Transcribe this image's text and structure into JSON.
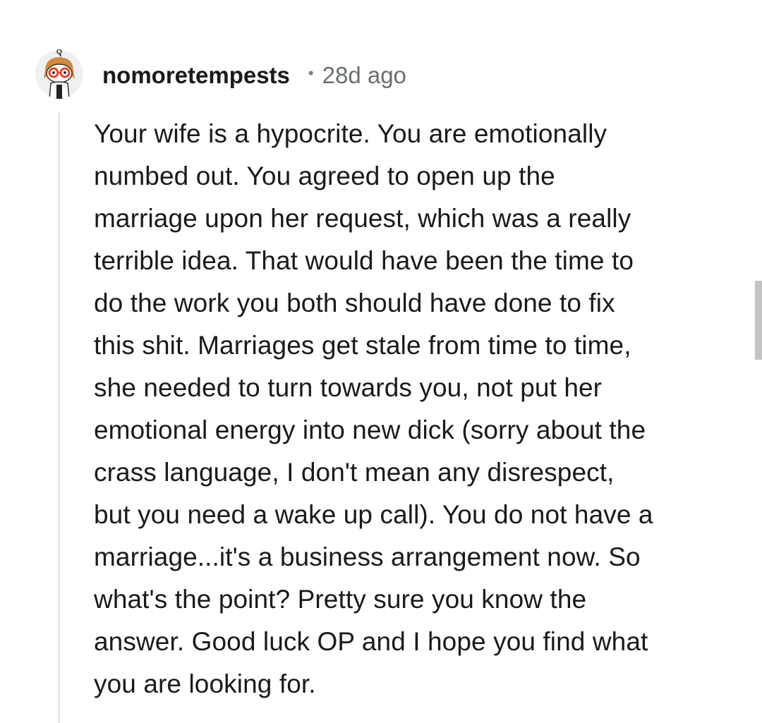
{
  "comment": {
    "author": "nomoretempests",
    "separator": "•",
    "timestamp": "28d ago",
    "avatar_icon": "reddit-snoo-avatar-icon",
    "body_lines": [
      "Your wife is a hypocrite. You are emotionally",
      "numbed out. You agreed to open up the",
      "marriage upon her request, which was a really",
      "terrible idea. That would have been the time to",
      "do the work you both should have done to fix",
      "this shit. Marriages get stale from time to time,",
      "she needed to turn towards you, not put her",
      "emotional energy into new dick (sorry about the",
      "crass language, I don't mean any disrespect,",
      "but you need a wake up call). You do not have a",
      "marriage...it's a business arrangement now. So",
      "what's the point? Pretty sure you know the",
      "answer. Good luck OP and I hope you find what",
      "you are looking for."
    ]
  },
  "colors": {
    "background": "#ffffff",
    "text": "#1a1a1b",
    "meta": "#6a6f73",
    "thread_line": "#e6e6e6",
    "avatar_hair": "#d28a3c",
    "avatar_glasses": "#e8452c"
  }
}
